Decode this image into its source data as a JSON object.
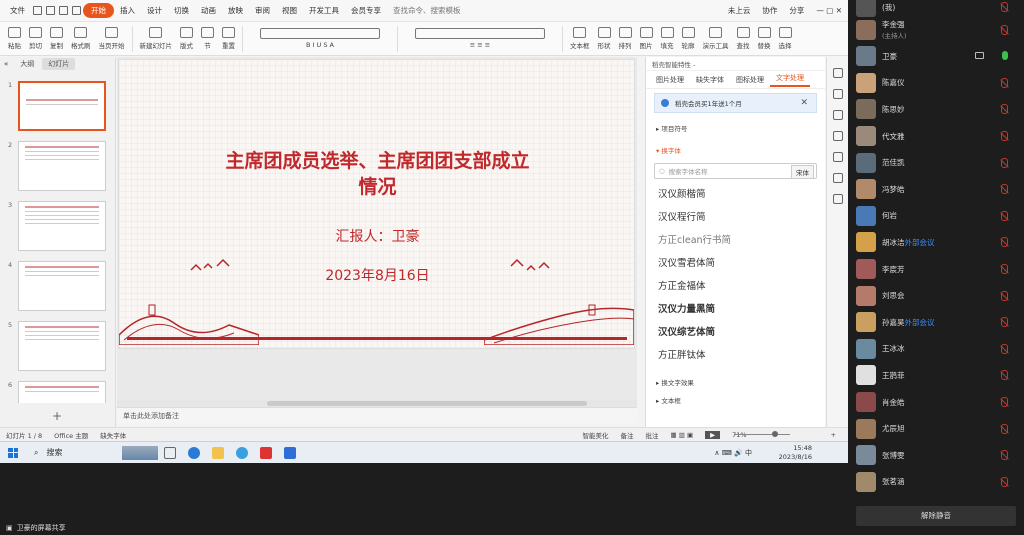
{
  "menubar": {
    "items": [
      "文件",
      "开始",
      "插入",
      "设计",
      "切换",
      "动画",
      "放映",
      "审阅",
      "视图",
      "开发工具",
      "会员专享",
      "查找命令、搜索模板"
    ],
    "right": [
      "未上云",
      "协作",
      "分享"
    ]
  },
  "ribbon": {
    "buttons": [
      "粘贴",
      "剪切",
      "复制",
      "格式刷",
      "当页开始",
      "新建幻灯片",
      "版式",
      "节",
      "重置",
      "文本框",
      "形状",
      "排列",
      "图片",
      "填充",
      "轮廓",
      "演示工具",
      "查找",
      "替换",
      "选择"
    ]
  },
  "left_panel": {
    "tabs": [
      "大纲",
      "幻灯片"
    ],
    "slides": [
      "1",
      "2",
      "3",
      "4",
      "5",
      "6"
    ]
  },
  "slide": {
    "title_line1": "主席团成员选举、主席团团支部成立",
    "title_line2": "情况",
    "reporter": "汇报人：卫豪",
    "date": "2023年8月16日"
  },
  "notes": {
    "placeholder": "单击此处添加备注"
  },
  "right_panel": {
    "header": "稻壳智能特性 -",
    "tabs": [
      "图片处理",
      "缺失字体",
      "图标处理",
      "文字处理"
    ],
    "notice": "稻壳会员买1年送1个月",
    "section_bullets": "项目符号",
    "section_font": "换字体",
    "search_placeholder": "搜索字体名称",
    "search_button": "宋体",
    "fonts": [
      "汉仪颜楷简",
      "汉仪程行简",
      "方正clean行书简",
      "汉仪雪君体简",
      "方正金福体",
      "汉仪力量黑简",
      "汉仪综艺体简",
      "方正胖钛体"
    ],
    "effects": "换文字效果",
    "more": "文本框"
  },
  "statusbar": {
    "slide_pos": "幻灯片 1 / 8",
    "theme": "Office 主题",
    "missing_font": "缺失字体",
    "beautify": "智能美化",
    "notes_btn": "备注",
    "comment_btn": "批注",
    "zoom": "71%"
  },
  "taskbar": {
    "search": "搜索",
    "time": "15:48",
    "date": "2023/8/16",
    "ime": "中"
  },
  "participants": [
    {
      "name": "(我)",
      "sub": ""
    },
    {
      "name": "李金强",
      "sub": "(主持人)"
    },
    {
      "name": "卫豪",
      "sub": ""
    },
    {
      "name": "陈嘉仪",
      "sub": ""
    },
    {
      "name": "陈思妙",
      "sub": ""
    },
    {
      "name": "代文雅",
      "sub": ""
    },
    {
      "name": "范佳凯",
      "sub": ""
    },
    {
      "name": "冯梦皓",
      "sub": ""
    },
    {
      "name": "何岩",
      "sub": ""
    },
    {
      "name": "胡冰洁",
      "sub": "外部会议"
    },
    {
      "name": "李宸芳",
      "sub": ""
    },
    {
      "name": "刘思会",
      "sub": ""
    },
    {
      "name": "孙嘉昊",
      "sub": "外部会议"
    },
    {
      "name": "王冰冰",
      "sub": ""
    },
    {
      "name": "王鹊菲",
      "sub": ""
    },
    {
      "name": "肖金皓",
      "sub": ""
    },
    {
      "name": "尤辰旭",
      "sub": ""
    },
    {
      "name": "张博雯",
      "sub": ""
    },
    {
      "name": "张茗涵",
      "sub": ""
    }
  ],
  "unmute_all": "解除静音",
  "share_label": "卫豪的屏幕共享",
  "colors": {
    "accent": "#e8541e",
    "slide_red": "#c0282b",
    "panel_dark": "#1d1d1d"
  }
}
